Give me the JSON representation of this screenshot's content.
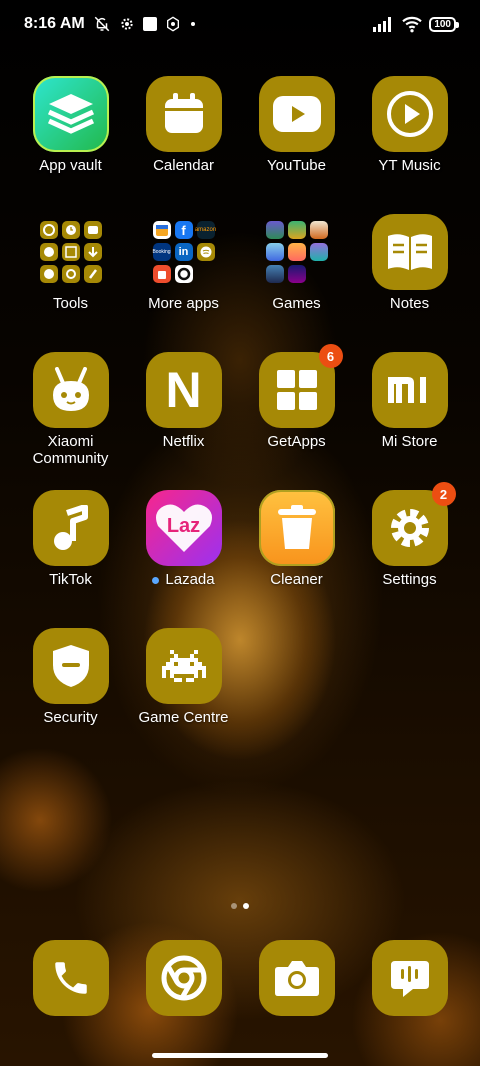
{
  "status": {
    "time": "8:16 AM",
    "battery": "100"
  },
  "apps": [
    {
      "name": "app-vault",
      "label": "App vault"
    },
    {
      "name": "calendar",
      "label": "Calendar"
    },
    {
      "name": "youtube",
      "label": "YouTube"
    },
    {
      "name": "yt-music",
      "label": "YT Music"
    },
    {
      "name": "tools-folder",
      "label": "Tools"
    },
    {
      "name": "more-apps-folder",
      "label": "More apps"
    },
    {
      "name": "games-folder",
      "label": "Games"
    },
    {
      "name": "notes",
      "label": "Notes"
    },
    {
      "name": "xiaomi-community",
      "label": "Xiaomi Community"
    },
    {
      "name": "netflix",
      "label": "Netflix",
      "glyph": "N"
    },
    {
      "name": "getapps",
      "label": "GetApps",
      "badge": "6"
    },
    {
      "name": "mi-store",
      "label": "Mi Store",
      "glyph": "mi"
    },
    {
      "name": "tiktok",
      "label": "TikTok"
    },
    {
      "name": "lazada",
      "label": "Lazada",
      "glyph": "Laz"
    },
    {
      "name": "cleaner",
      "label": "Cleaner"
    },
    {
      "name": "settings",
      "label": "Settings",
      "badge": "2"
    },
    {
      "name": "security",
      "label": "Security"
    },
    {
      "name": "game-centre",
      "label": "Game Centre"
    }
  ],
  "dock": [
    {
      "name": "phone",
      "label": "Phone"
    },
    {
      "name": "chrome",
      "label": "Chrome"
    },
    {
      "name": "camera",
      "label": "Camera"
    },
    {
      "name": "messaging",
      "label": "Messaging"
    }
  ],
  "folders": {
    "more_apps": [
      "booking",
      "facebook",
      "amazon",
      "mini-app",
      "linkedin",
      "spotify",
      "shopee",
      "bolt"
    ],
    "more_apps_text": {
      "booking": "Booking",
      "facebook": "f",
      "amazon": "amazon",
      "linkedin": "in"
    }
  },
  "colors": {
    "tile": "#a68906",
    "badge": "#ec4e12",
    "vault_a": "#28e0c0",
    "vault_b": "#2cc060"
  },
  "page_indicator": {
    "pages": 2,
    "active": 2
  }
}
